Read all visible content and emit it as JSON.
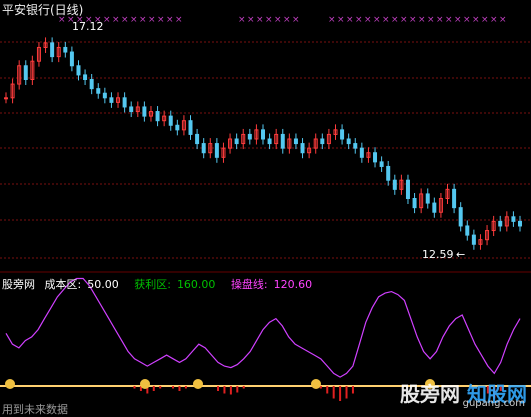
{
  "header": {
    "stock_title": "平安银行(日线)"
  },
  "price_labels": {
    "high": "17.12",
    "low": "12.59",
    "low_arrow": "←"
  },
  "indicator": {
    "name": "股旁网",
    "cost": {
      "label": "成本区:",
      "value": "50.00",
      "color": "#ffffff"
    },
    "profit": {
      "label": "获利区:",
      "value": "160.00",
      "color": "#00c000"
    },
    "control": {
      "label": "操盘线:",
      "value": "120.60",
      "color": "#ff44ff"
    }
  },
  "footnote": "用到未来数据",
  "watermark": {
    "text": "股旁网",
    "url": "gupang.com",
    "brand": "知股网",
    "brand_url": "rayluo.com"
  },
  "colors": {
    "bg": "#000000",
    "up": "#ff3c3c",
    "down": "#54c8f0",
    "grid": "#7a1010",
    "mark": "#c040c0",
    "line": "#d040ff",
    "base": "#ffd070"
  },
  "chart_data": {
    "type": "candlestick",
    "candles_close": [
      15.8,
      16.1,
      16.5,
      16.2,
      16.6,
      16.9,
      17.0,
      16.7,
      16.9,
      16.8,
      16.5,
      16.3,
      16.2,
      16.0,
      15.9,
      15.8,
      15.7,
      15.8,
      15.6,
      15.5,
      15.6,
      15.4,
      15.5,
      15.3,
      15.4,
      15.2,
      15.1,
      15.3,
      15.0,
      14.8,
      14.6,
      14.8,
      14.5,
      14.7,
      14.9,
      14.8,
      15.0,
      14.9,
      15.1,
      14.9,
      14.8,
      15.0,
      14.7,
      14.9,
      14.8,
      14.6,
      14.7,
      14.9,
      14.8,
      15.0,
      15.1,
      14.9,
      14.8,
      14.7,
      14.5,
      14.6,
      14.4,
      14.3,
      14.0,
      13.8,
      14.0,
      13.6,
      13.4,
      13.7,
      13.5,
      13.3,
      13.6,
      13.8,
      13.4,
      13.0,
      12.8,
      12.6,
      12.7,
      12.9,
      13.1,
      13.0,
      13.2,
      13.1,
      13.0
    ],
    "indicator_line": [
      75,
      60,
      55,
      65,
      70,
      80,
      95,
      110,
      125,
      135,
      145,
      150,
      150,
      140,
      125,
      110,
      95,
      80,
      65,
      50,
      40,
      35,
      30,
      35,
      40,
      45,
      40,
      35,
      40,
      50,
      60,
      55,
      45,
      35,
      30,
      28,
      32,
      40,
      50,
      65,
      80,
      90,
      95,
      85,
      70,
      60,
      55,
      50,
      45,
      40,
      30,
      20,
      15,
      20,
      30,
      60,
      90,
      110,
      125,
      130,
      132,
      128,
      120,
      95,
      70,
      50,
      40,
      50,
      70,
      85,
      95,
      100,
      80,
      60,
      45,
      30,
      20,
      35,
      60,
      80,
      95
    ]
  }
}
